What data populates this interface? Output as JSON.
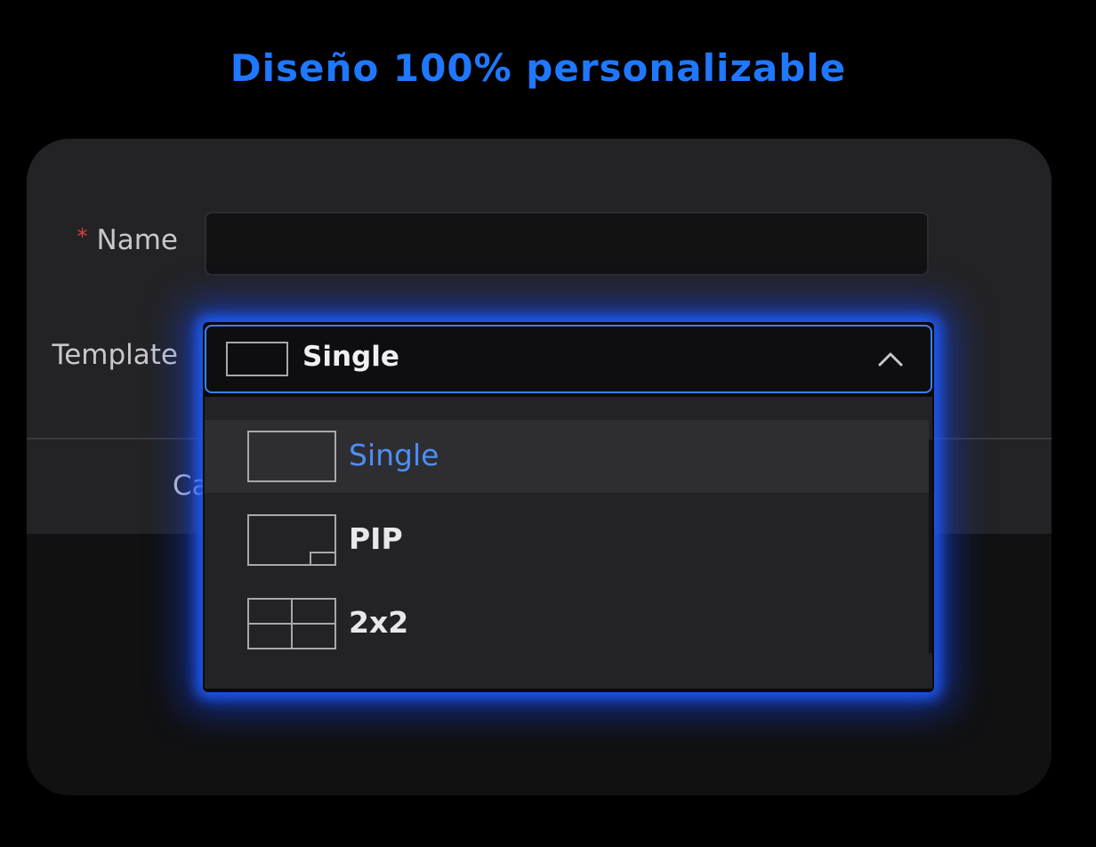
{
  "headline": "Diseño 100% personalizable",
  "form": {
    "name_label": "Name",
    "name_required_mark": "*",
    "name_value": "",
    "template_label": "Template",
    "template_selected": "Single",
    "cancel_label_partial": "Ca"
  },
  "dropdown": {
    "state": "open",
    "options": [
      {
        "label": "Single",
        "icon": "single-layout-icon",
        "active": true
      },
      {
        "label": "PIP",
        "icon": "pip-layout-icon",
        "active": false
      },
      {
        "label": "2x2",
        "icon": "grid-2x2-layout-icon",
        "active": false
      }
    ]
  },
  "colors": {
    "accent": "#1f78ff",
    "active_option": "#4c8ff5",
    "glow": "#1f5fff",
    "required": "#e0413a"
  }
}
